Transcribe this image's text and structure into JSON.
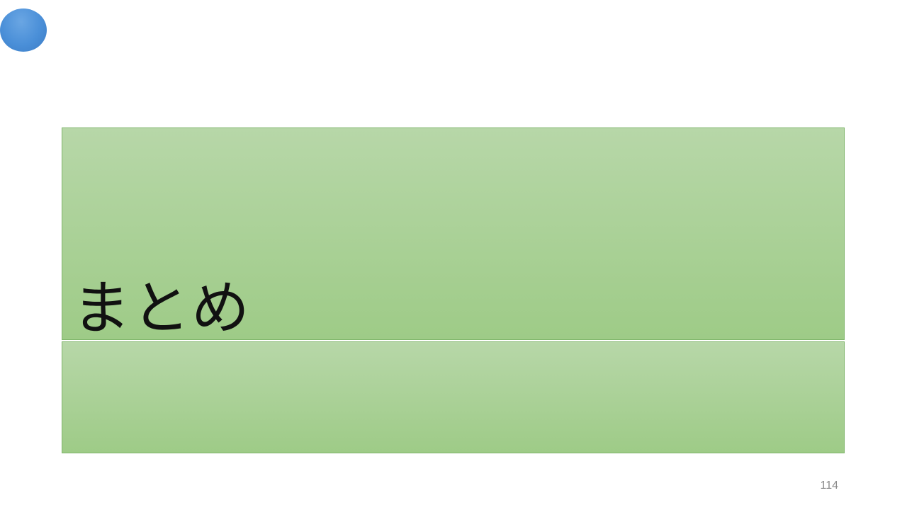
{
  "slide": {
    "title": "まとめ",
    "page_number": "114"
  },
  "colors": {
    "panel_top": "#b7d7a8",
    "panel_bottom": "#9ecb87",
    "panel_border": "#7fb56a",
    "dot": "#4a8fd8"
  }
}
